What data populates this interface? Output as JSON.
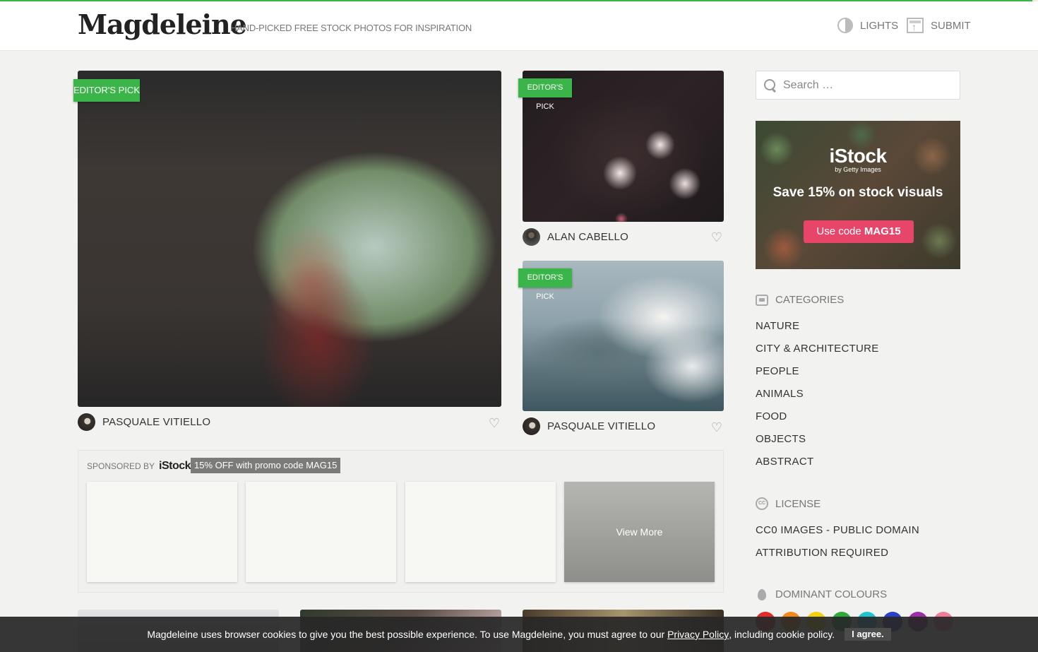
{
  "header": {
    "logo": "Magdeleine",
    "tagline": "HAND-PICKED FREE STOCK PHOTOS FOR INSPIRATION",
    "nav": {
      "lights_label": "LIGHTS",
      "lights_icon": "half-circle-icon",
      "submit_label": "SUBMIT",
      "submit_icon": "upload-icon"
    }
  },
  "photos": [
    {
      "badge": "EDITOR'S PICK",
      "author": "PASQUALE VITIELLO",
      "subject": "woman in car window"
    },
    {
      "badge": "EDITOR'S PICK",
      "author": "ALAN CABELLO",
      "subject": "pink oleander flowers"
    },
    {
      "badge": "EDITOR'S PICK",
      "author": "PASQUALE VITIELLO",
      "subject": "coast under clouds aerial"
    }
  ],
  "sponsor": {
    "label": "SPONSORED BY",
    "brand": "iStock",
    "promo": "15% OFF with promo code MAG15",
    "view_more": "View More"
  },
  "sidebar": {
    "search_placeholder": "Search …",
    "ad": {
      "logo": "iStock",
      "logo_sub": "by Getty Images",
      "headline": "Save 15% on stock visuals",
      "cta_prefix": "Use code ",
      "cta_code": "MAG15"
    },
    "categories_title": "CATEGORIES",
    "categories": [
      "NATURE",
      "CITY & ARCHITECTURE",
      "PEOPLE",
      "ANIMALS",
      "FOOD",
      "OBJECTS",
      "ABSTRACT"
    ],
    "license_title": "LICENSE",
    "licenses": [
      "CC0 IMAGES - PUBLIC DOMAIN",
      "ATTRIBUTION REQUIRED"
    ],
    "colours_title": "DOMINANT COLOURS",
    "colours": [
      "#e02b2b",
      "#f08a1c",
      "#f2d00c",
      "#31a93a",
      "#20c4cf",
      "#2b3fc9",
      "#9b2fa3",
      "#f07c99"
    ]
  },
  "cookie": {
    "text_before": "Magdeleine uses browser cookies to give you the best possible experience. To use Magdeleine, you must agree to our ",
    "link": "Privacy Policy",
    "text_after": ", including cookie policy.",
    "button": "I agree."
  }
}
